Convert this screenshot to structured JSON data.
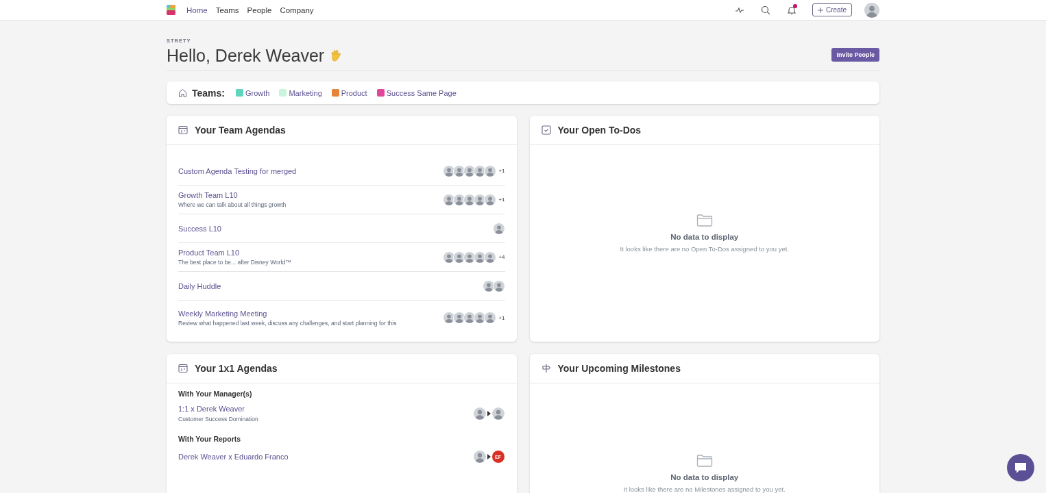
{
  "nav": {
    "links": [
      {
        "label": "Home",
        "selected": true
      },
      {
        "label": "Teams",
        "selected": false
      },
      {
        "label": "People",
        "selected": false
      },
      {
        "label": "Company",
        "selected": false
      }
    ],
    "create": "Create",
    "notifications_unread": true
  },
  "header": {
    "org": "STRETY",
    "greeting": "Hello, Derek Weaver",
    "invite": "Invite People"
  },
  "teams": {
    "label": "Teams:",
    "items": [
      {
        "name": "Growth",
        "color": "#5dd6c0"
      },
      {
        "name": "Marketing",
        "color": "#c8f5dc"
      },
      {
        "name": "Product",
        "color": "#e8843a"
      },
      {
        "name": "Success Same Page",
        "color": "#e0479b"
      }
    ]
  },
  "team_agendas": {
    "title": "Your Team Agendas",
    "rows": [
      {
        "title": "Custom Agenda Testing for merged",
        "avatars": [
          {
            "kind": "photo"
          },
          {
            "kind": "photo"
          },
          {
            "kind": "photo"
          },
          {
            "kind": "photo"
          },
          {
            "kind": "photo"
          }
        ],
        "more": "+1"
      },
      {
        "title": "Growth Team L10",
        "subtitle": "Where we can talk about all things growth",
        "avatars": [
          {
            "kind": "photo"
          },
          {
            "kind": "photo"
          },
          {
            "kind": "photo"
          },
          {
            "kind": "photo"
          },
          {
            "kind": "photo"
          }
        ],
        "more": "+1"
      },
      {
        "title": "Success L10",
        "avatars": [
          {
            "kind": "photo"
          }
        ]
      },
      {
        "title": "Product Team L10",
        "subtitle": "The best place to be... after Disney World™",
        "avatars": [
          {
            "kind": "photo"
          },
          {
            "kind": "photo"
          },
          {
            "kind": "photo"
          },
          {
            "kind": "photo"
          },
          {
            "kind": "photo"
          }
        ],
        "more": "+4"
      },
      {
        "title": "Daily Huddle",
        "avatars": [
          {
            "kind": "photo"
          },
          {
            "kind": "photo"
          }
        ]
      },
      {
        "title": "Weekly Marketing Meeting",
        "subtitle": "Review what happened last week, discuss any challenges, and start planning for this",
        "avatars": [
          {
            "kind": "photo"
          },
          {
            "kind": "photo"
          },
          {
            "kind": "photo"
          },
          {
            "kind": "photo"
          },
          {
            "kind": "photo"
          }
        ],
        "more": "+1"
      }
    ]
  },
  "open_todos": {
    "title": "Your Open To-Dos",
    "empty_title": "No data to display",
    "empty_text": "It looks like there are no Open To-Dos assigned to you yet."
  },
  "one_on_one": {
    "title": "Your 1x1 Agendas",
    "groups": [
      {
        "heading": "With Your Manager(s)",
        "rows": [
          {
            "title": "1:1 x Derek Weaver",
            "subtitle": "Customer Success Domination",
            "from": {
              "kind": "photo"
            },
            "to": {
              "kind": "photo"
            }
          }
        ]
      },
      {
        "heading": "With Your Reports",
        "rows": [
          {
            "title": "Derek Weaver x Eduardo Franco",
            "from": {
              "kind": "photo"
            },
            "to": {
              "kind": "initials",
              "text": "EF",
              "color": "#d93025"
            }
          }
        ]
      }
    ]
  },
  "milestones": {
    "title": "Your Upcoming Milestones",
    "empty_title": "No data to display",
    "empty_text": "It looks like there are no Milestones assigned to you yet."
  }
}
